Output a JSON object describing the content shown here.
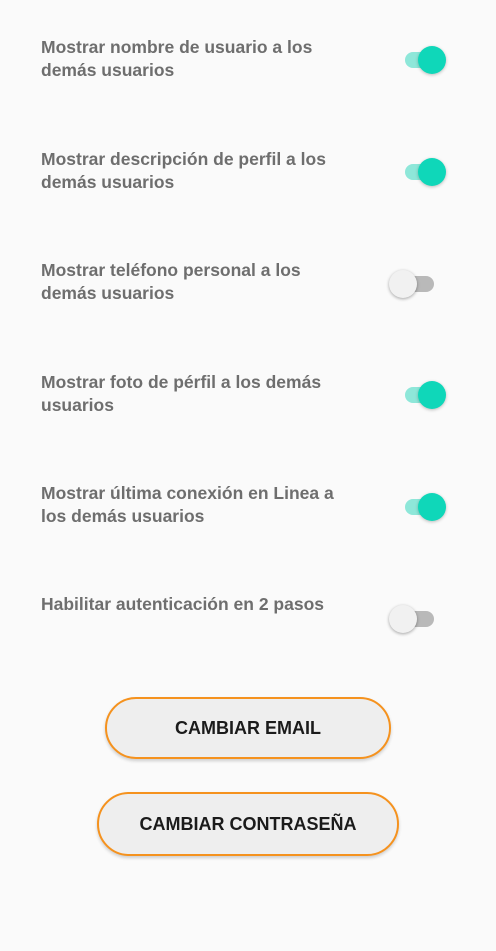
{
  "settings": [
    {
      "label": "Mostrar nombre de usuario a los demás usuarios",
      "state": "on"
    },
    {
      "label": "Mostrar descripción de perfil a los demás usuarios",
      "state": "on"
    },
    {
      "label": "Mostrar teléfono personal a los demás usuarios",
      "state": "off"
    },
    {
      "label": "Mostrar foto de pérfil a los demás usuarios",
      "state": "on"
    },
    {
      "label": "Mostrar última conexión en Linea a los demás usuarios",
      "state": "on"
    },
    {
      "label": "Habilitar autenticación en 2 pasos",
      "state": "off"
    }
  ],
  "buttons": {
    "change_email": "CAMBIAR EMAIL",
    "change_password": "CAMBIAR CONTRASEÑA"
  },
  "colors": {
    "toggle_on_thumb": "#0fd7b9",
    "toggle_on_track": "#8ee7d9",
    "toggle_off_thumb": "#f1f1f1",
    "toggle_off_track": "#b9b9b9",
    "button_border": "#f5921e",
    "label_text": "#6e6e6e"
  }
}
